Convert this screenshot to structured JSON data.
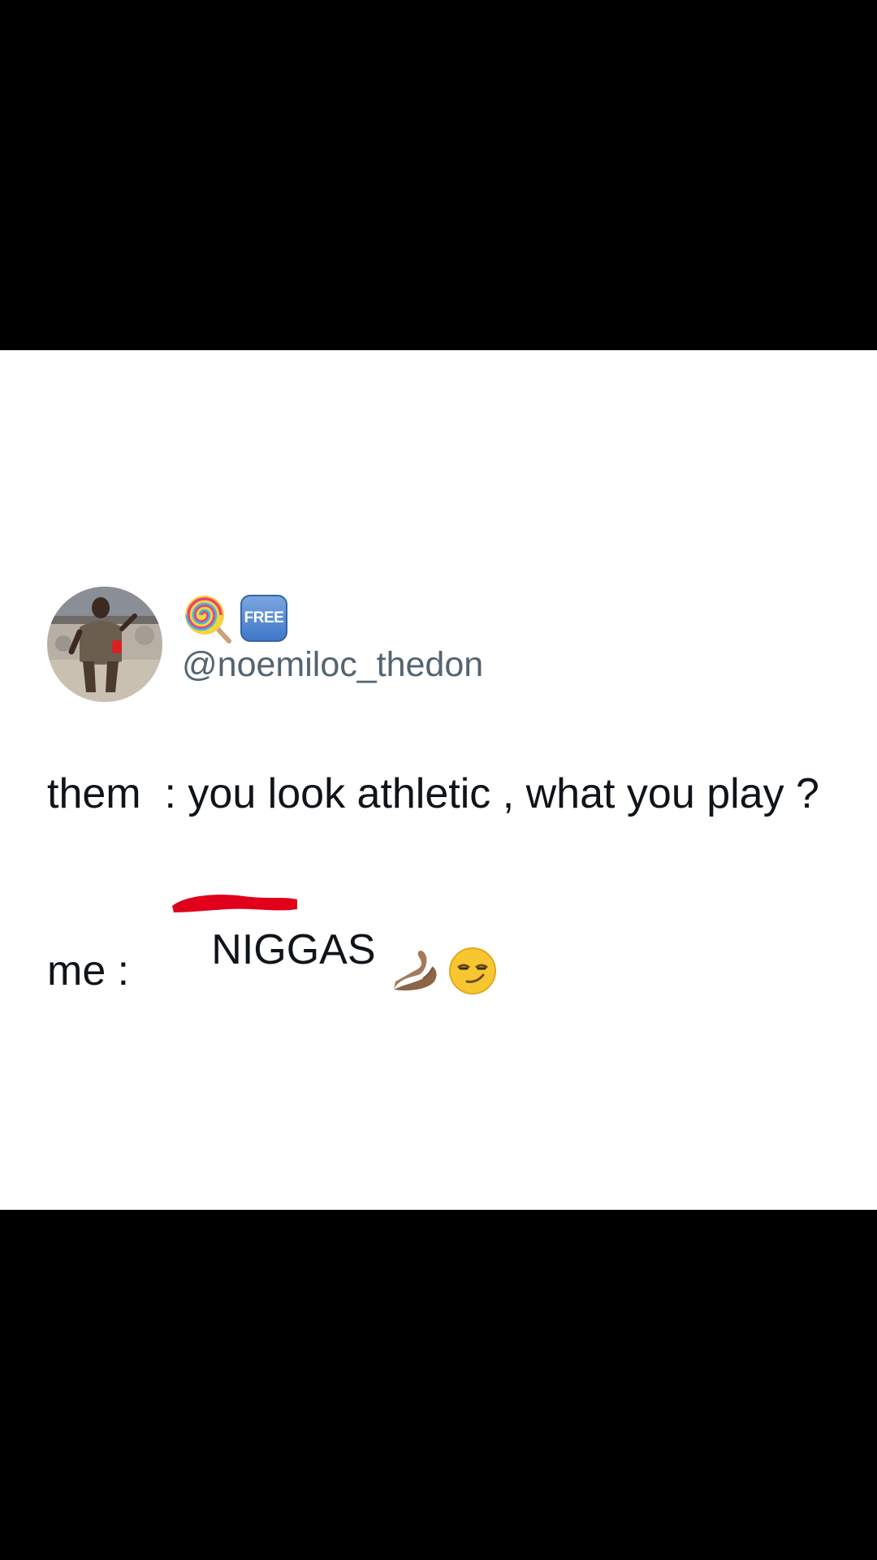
{
  "tweet": {
    "name_badges": {
      "lollipop_icon": "lollipop-icon",
      "free_badge_label": "FREE"
    },
    "handle": "@noemiloc_thedon",
    "lines": {
      "line1": "them  : you look athletic , what you play ?",
      "line2_prefix": "me : ",
      "line2_word": "NIGGAS",
      "line2_word_redacted": true
    },
    "emojis": [
      "ok-hand-pinch-icon",
      "smirk-face-icon"
    ]
  },
  "colors": {
    "handle": "#536471",
    "text": "#0f1419",
    "redaction": "#e0001b",
    "background": "#ffffff",
    "letterbox": "#000000"
  }
}
